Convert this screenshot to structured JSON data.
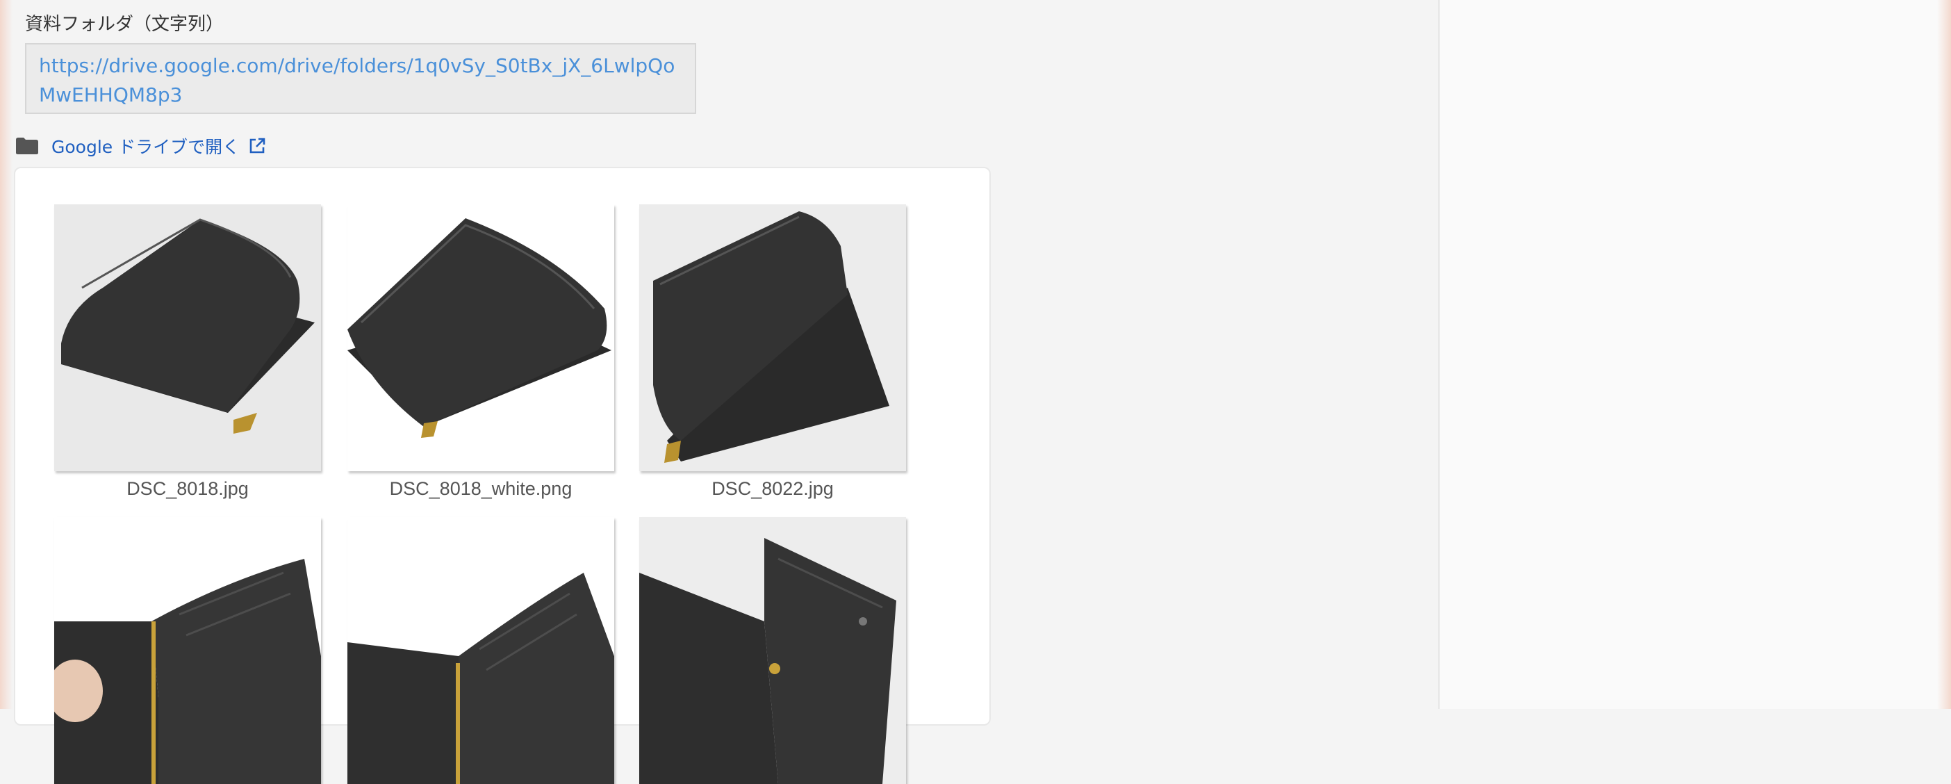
{
  "field": {
    "label": "資料フォルダ（文字列）",
    "url_line1": "https://drive.google.com/drive/folders/1q0vSy_S0tBx_jX_6LwlpQo",
    "url_line2": "MwEHHQM8p3"
  },
  "drive": {
    "link_label": "Google ドライブで開く",
    "folder_icon": "folder-icon",
    "external_icon": "external-link-icon"
  },
  "files": [
    {
      "name": "DSC_8018.jpg"
    },
    {
      "name": "DSC_8018_white.png"
    },
    {
      "name": "DSC_8022.jpg"
    },
    {
      "name": ""
    },
    {
      "name": ""
    },
    {
      "name": ""
    }
  ],
  "colors": {
    "link": "#1f5fc0",
    "url_text": "#4a90d9",
    "page_bg": "#f4f4f4"
  }
}
